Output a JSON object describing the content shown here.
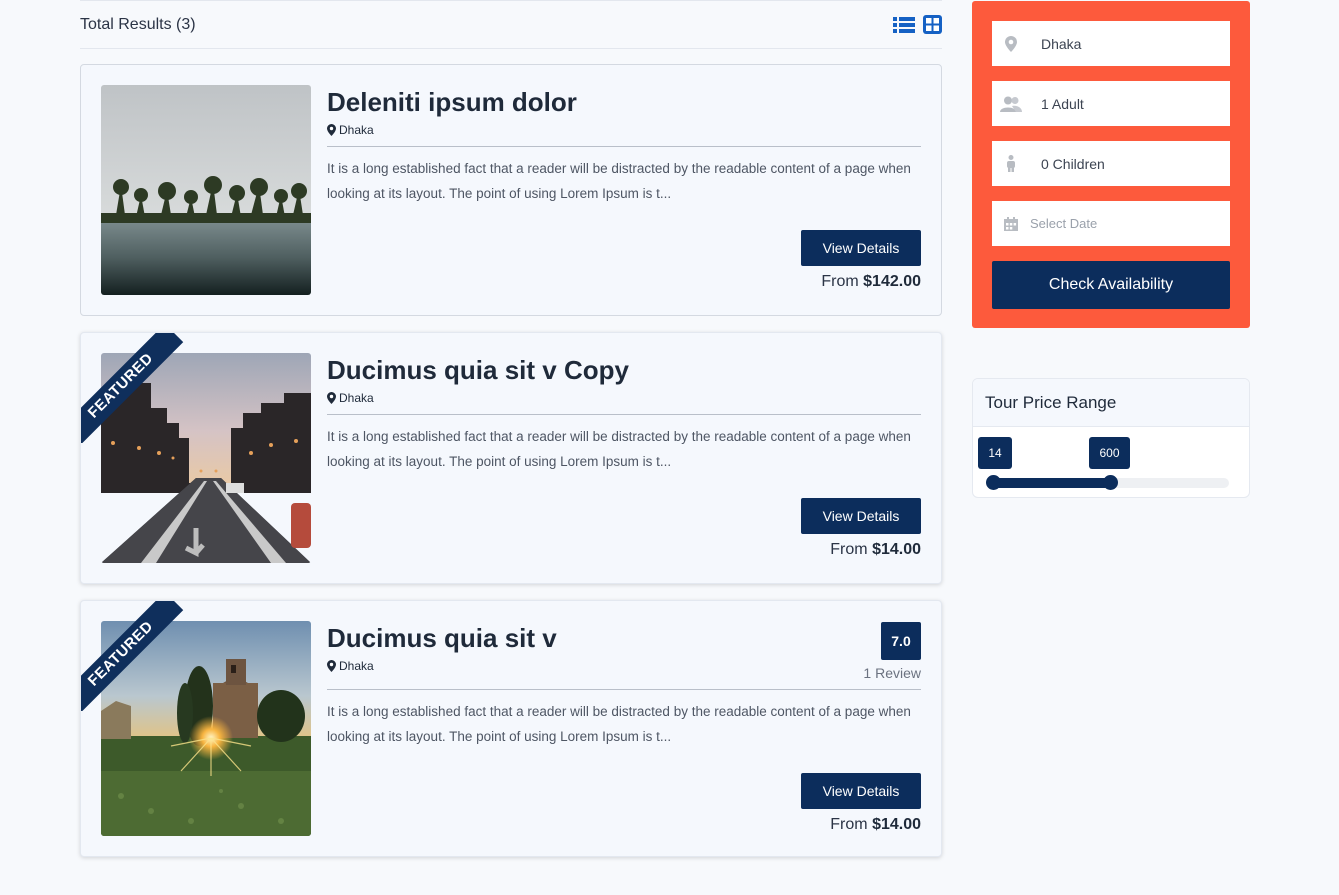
{
  "results": {
    "total_label": "Total Results (3)",
    "view_list_icon": "list-view-icon",
    "view_grid_icon": "grid-view-icon"
  },
  "tours": [
    {
      "title": "Deleniti ipsum dolor",
      "location": "Dhaka",
      "description": "It is a long established fact that a reader will be distracted by the readable content of a page when looking at its layout. The point of using Lorem Ipsum is t...",
      "button_label": "View Details",
      "price_prefix": "From",
      "price": "$142.00",
      "featured": false,
      "image": "beach-palm-trees"
    },
    {
      "title": "Ducimus quia sit v Copy",
      "location": "Dhaka",
      "description": "It is a long established fact that a reader will be distracted by the readable content of a page when looking at its layout. The point of using Lorem Ipsum is t...",
      "button_label": "View Details",
      "price_prefix": "From",
      "price": "$14.00",
      "featured": true,
      "featured_label": "FEATURED",
      "image": "city-street-dusk"
    },
    {
      "title": "Ducimus quia sit v",
      "location": "Dhaka",
      "description": "It is a long established fact that a reader will be distracted by the readable content of a page when looking at its layout. The point of using Lorem Ipsum is t...",
      "button_label": "View Details",
      "price_prefix": "From",
      "price": "$14.00",
      "featured": true,
      "featured_label": "FEATURED",
      "rating": "7.0",
      "reviews": "1 Review",
      "image": "chapel-sunset"
    }
  ],
  "booking": {
    "location_value": "Dhaka",
    "adults_value": "1 Adult",
    "children_value": "0 Children",
    "date_placeholder": "Select Date",
    "check_button": "Check Availability",
    "background_color": "#fd5a3c",
    "accent_color": "#0c2d5c"
  },
  "price_range": {
    "title": "Tour Price Range",
    "min_value": "14",
    "max_value": "600"
  }
}
